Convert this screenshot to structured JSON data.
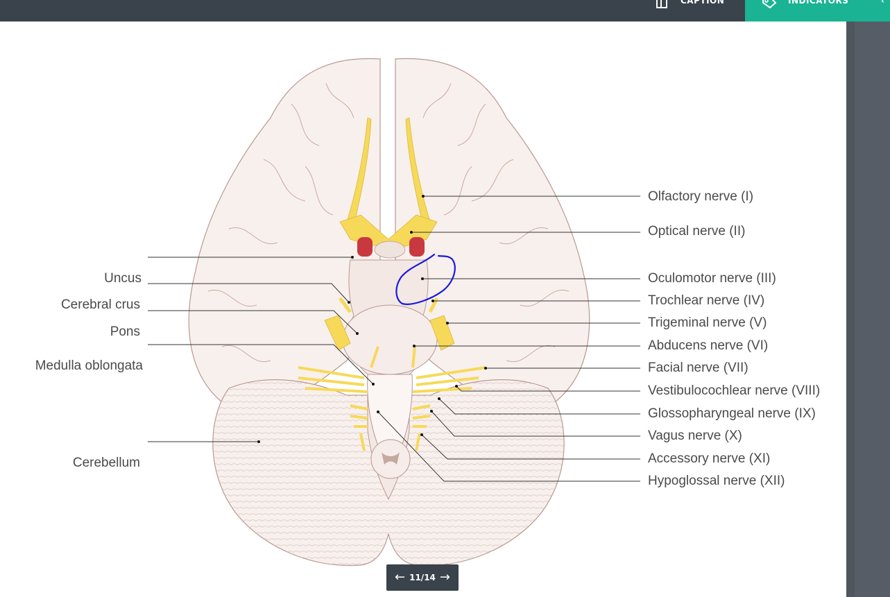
{
  "toolbar": {
    "caption_label": "CAPTION",
    "indicators_label": "INDICATORS",
    "caption_icon": "book-icon",
    "indicators_icon": "tag-icon",
    "active_color": "#1ab394",
    "bar_color": "#3a424b"
  },
  "labels_left": {
    "uncus": "Uncus",
    "cerebral_crus": "Cerebral crus",
    "pons": "Pons",
    "medulla": "Medulla oblongata",
    "cerebellum": "Cerebellum"
  },
  "labels_right": {
    "n1": "Olfactory nerve (I)",
    "n2": "Optical nerve (II)",
    "n3": "Oculomotor nerve (III)",
    "n4": "Trochlear nerve (IV)",
    "n5": "Trigeminal nerve (V)",
    "n6": "Abducens nerve (VI)",
    "n7": "Facial nerve (VII)",
    "n8": "Vestibulocochlear nerve (VIII)",
    "n9": "Glossopharyngeal nerve (IX)",
    "n10": "Vagus nerve (X)",
    "n11": "Accessory nerve (XI)",
    "n12": "Hypoglossal nerve (XII)"
  },
  "pager": {
    "current": "11/14",
    "prev_icon": "arrow-left-icon",
    "next_icon": "arrow-right-icon"
  },
  "colors": {
    "brain_fill": "#f8f0ed",
    "nerve_fill": "#f7d95a",
    "artery_red": "#c8383e",
    "annotation_blue": "#1a1adc"
  }
}
